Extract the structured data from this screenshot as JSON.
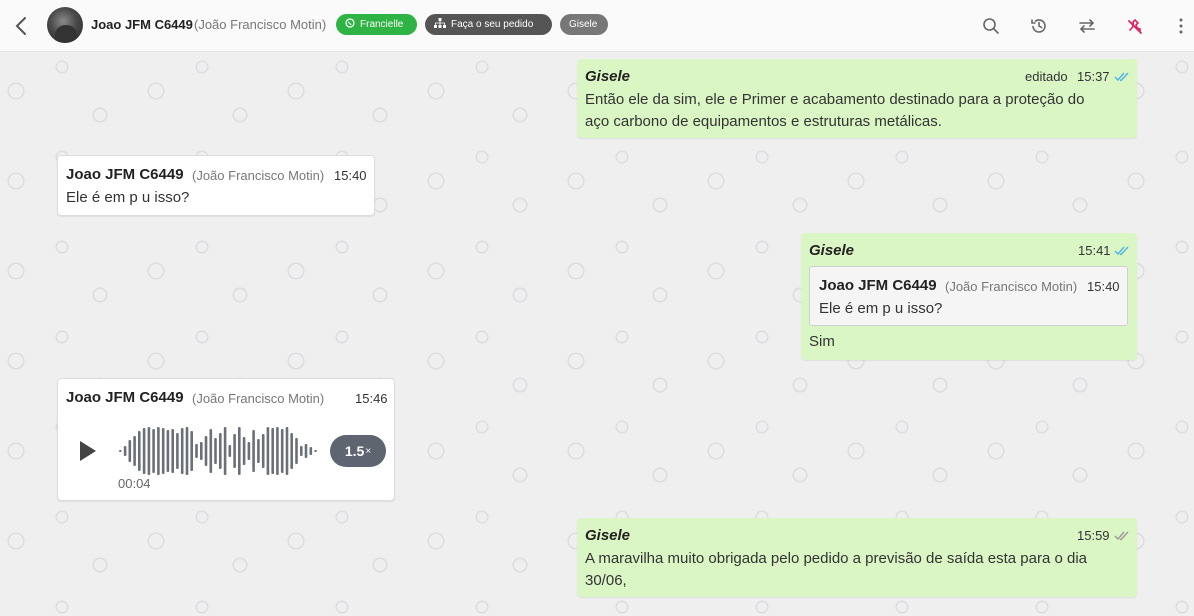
{
  "header": {
    "contact_name": "Joao JFM C6449",
    "contact_subtitle": "(João Francisco Motin)",
    "tags": [
      {
        "label": "Francielle",
        "icon": "whatsapp-icon",
        "color": "#2fb344"
      },
      {
        "label": "Faça o seu pedido",
        "icon": "sitemap-icon",
        "color": "#555555"
      },
      {
        "label": "Gisele",
        "icon": "",
        "color": "#777777"
      }
    ]
  },
  "messages": [
    {
      "direction": "out",
      "sender": "Gisele",
      "edited_label": "editado",
      "time": "15:37",
      "status": "read",
      "lines": [
        "Então ele da sim, ele e Primer e acabamento destinado para a proteção do",
        "aço carbono de equipamentos e estruturas metálicas."
      ]
    },
    {
      "direction": "in",
      "sender": "Joao JFM C6449",
      "sender_sub": "(João Francisco Motin)",
      "time": "15:40",
      "text": "Ele é em p u isso?"
    },
    {
      "direction": "out",
      "sender": "Gisele",
      "time": "15:41",
      "status": "read",
      "quote": {
        "sender": "Joao JFM C6449",
        "sender_sub": "(João Francisco Motin)",
        "time": "15:40",
        "text": "Ele é em p u isso?"
      },
      "text": "Sim"
    },
    {
      "direction": "in",
      "sender": "Joao JFM C6449",
      "sender_sub": "(João Francisco Motin)",
      "time": "15:46",
      "audio": {
        "duration": "00:04",
        "speed": "1.5",
        "speed_suffix": "×"
      }
    },
    {
      "direction": "out",
      "sender": "Gisele",
      "time": "15:59",
      "status": "delivered",
      "lines": [
        "A maravilha muito obrigada pelo pedido a previsão de saída esta para o dia",
        "30/06,"
      ]
    }
  ],
  "colors": {
    "read_ticks": "#4fb3e8",
    "delivered_ticks": "#999999",
    "outgoing_bubble": "#dbf6c5",
    "close_chat_icon": "#e0245e"
  }
}
